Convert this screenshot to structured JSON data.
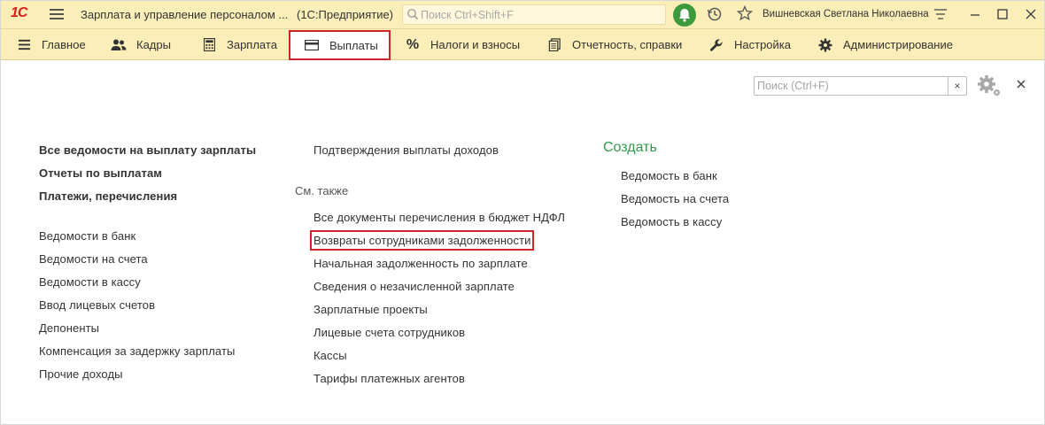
{
  "titlebar": {
    "logo": "1С",
    "app_title": "Зарплата и управление персоналом ...",
    "app_mode": "(1С:Предприятие)",
    "search_placeholder": "Поиск Ctrl+Shift+F",
    "user_name": "Вишневская Светлана Николаевна",
    "icons": [
      "logo-1c",
      "burger-menu-icon",
      "search-icon",
      "bell-icon",
      "history-icon",
      "star-icon",
      "settings-lines-icon",
      "minimize-icon",
      "maximize-icon",
      "close-icon"
    ]
  },
  "sections": [
    {
      "label": "Главное",
      "icon": "burger-icon",
      "active": false
    },
    {
      "label": "Кадры",
      "icon": "people-icon",
      "active": false
    },
    {
      "label": "Зарплата",
      "icon": "calculator-icon",
      "active": false
    },
    {
      "label": "Выплаты",
      "icon": "wallet-icon",
      "active": true
    },
    {
      "label": "Налоги и взносы",
      "icon": "percent-icon",
      "active": false
    },
    {
      "label": "Отчетность, справки",
      "icon": "documents-icon",
      "active": false
    },
    {
      "label": "Настройка",
      "icon": "wrench-icon",
      "active": false
    },
    {
      "label": "Администрирование",
      "icon": "gear-icon",
      "active": false
    }
  ],
  "panel": {
    "search_placeholder": "Поиск (Ctrl+F)",
    "clear_label": "×",
    "close_label": "×"
  },
  "column1": {
    "bold_links": [
      "Все ведомости на выплату зарплаты",
      "Отчеты по выплатам",
      "Платежи, перечисления"
    ],
    "links": [
      "Ведомости в банк",
      "Ведомости на счета",
      "Ведомости в кассу",
      "Ввод лицевых счетов",
      "Депоненты",
      "Компенсация за задержку зарплаты",
      "Прочие доходы"
    ]
  },
  "column2": {
    "top_link": "Подтверждения выплаты доходов",
    "see_also_header": "См. также",
    "see_also_links": [
      "Все документы перечисления в бюджет НДФЛ",
      "Возвраты сотрудниками задолженности",
      "Начальная задолженность по зарплате",
      "Сведения о незачисленной зарплате",
      "Зарплатные проекты",
      "Лицевые счета сотрудников",
      "Кассы",
      "Тарифы платежных агентов"
    ],
    "highlighted_link": "Возвраты сотрудниками задолженности"
  },
  "column3": {
    "create_header": "Создать",
    "links": [
      "Ведомость в банк",
      "Ведомость на счета",
      "Ведомость в кассу"
    ]
  },
  "colors": {
    "bar_bg": "#fbeeb8",
    "highlight": "#d2232a",
    "create_green": "#2e9c4b",
    "bell_green": "#3c9a3c",
    "logo_red": "#d8211c"
  }
}
